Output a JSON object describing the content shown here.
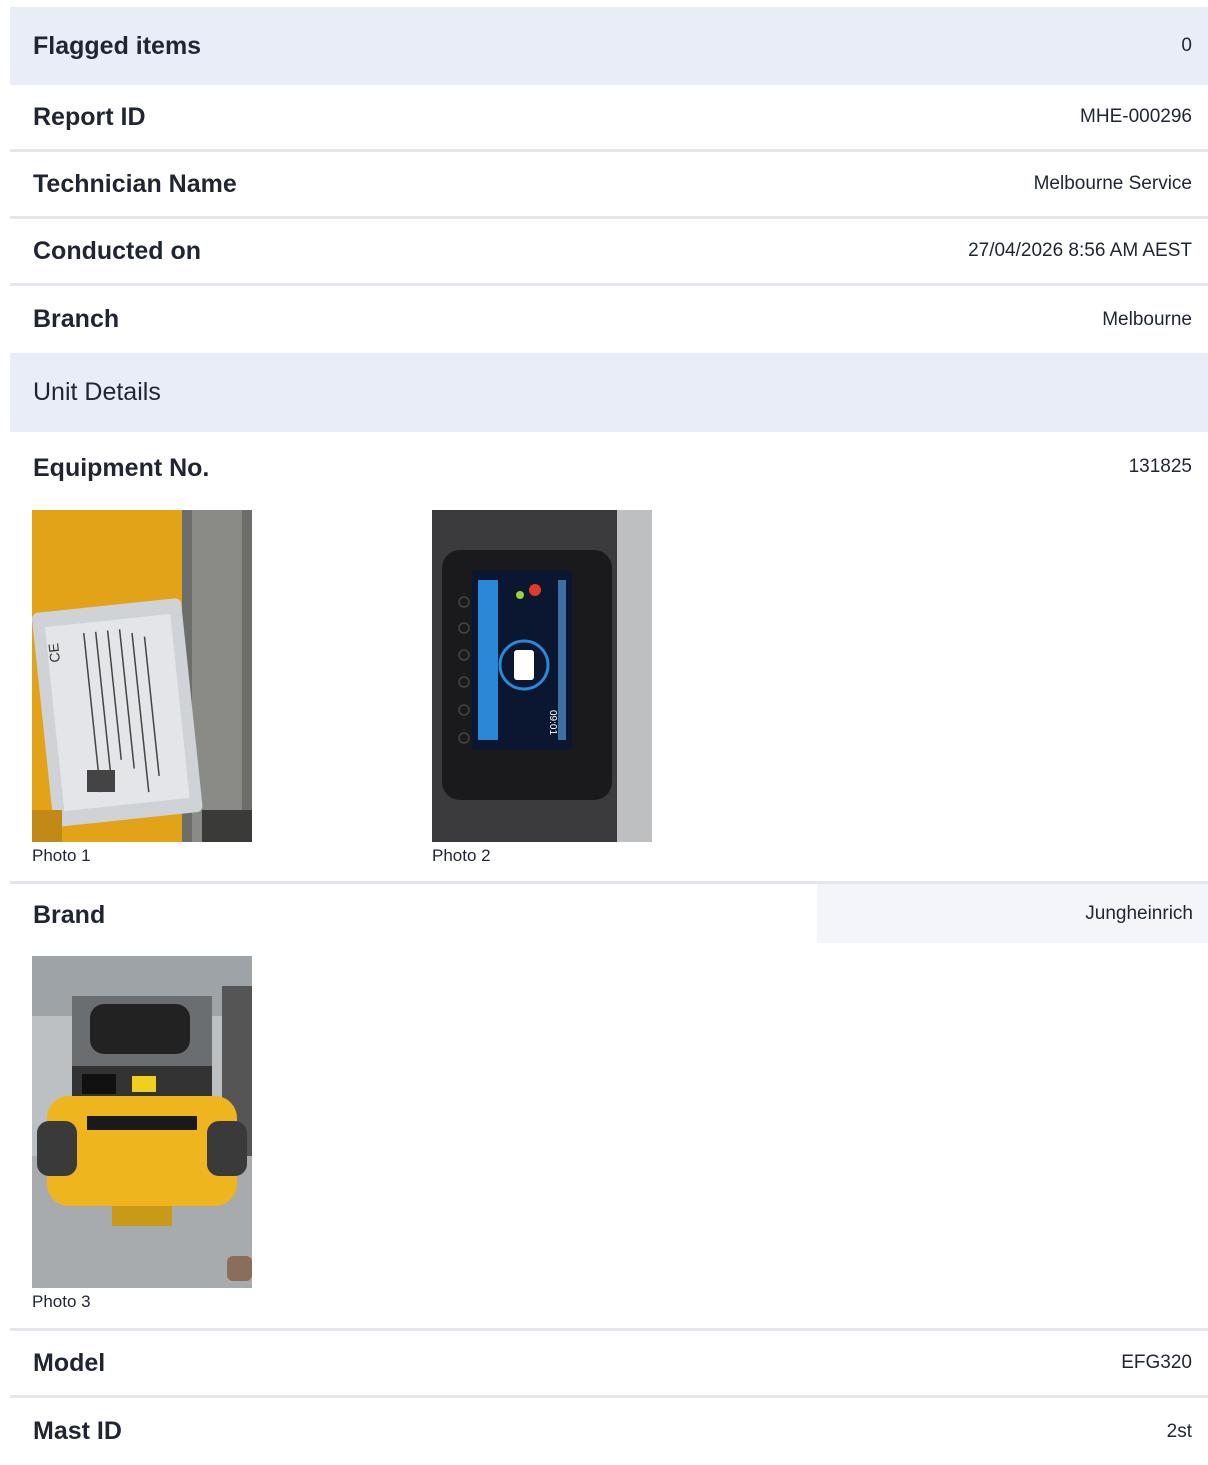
{
  "flagged": {
    "label": "Flagged items",
    "value": "0"
  },
  "fields": [
    {
      "label": "Report ID",
      "value": "MHE-000296"
    },
    {
      "label": "Technician Name",
      "value": "Melbourne Service"
    },
    {
      "label": "Conducted on",
      "value": "27/04/2026 8:56 AM AEST"
    },
    {
      "label": "Branch",
      "value": "Melbourne"
    }
  ],
  "section_title": "Unit Details",
  "equipment": {
    "label": "Equipment No.",
    "value": "131825",
    "photos": [
      {
        "caption": "Photo 1"
      },
      {
        "caption": "Photo 2"
      }
    ]
  },
  "brand": {
    "label": "Brand",
    "value": "Jungheinrich",
    "photos": [
      {
        "caption": "Photo 3"
      }
    ]
  },
  "model": {
    "label": "Model",
    "value": "EFG320"
  },
  "mast": {
    "label": "Mast ID",
    "value": "2st"
  }
}
